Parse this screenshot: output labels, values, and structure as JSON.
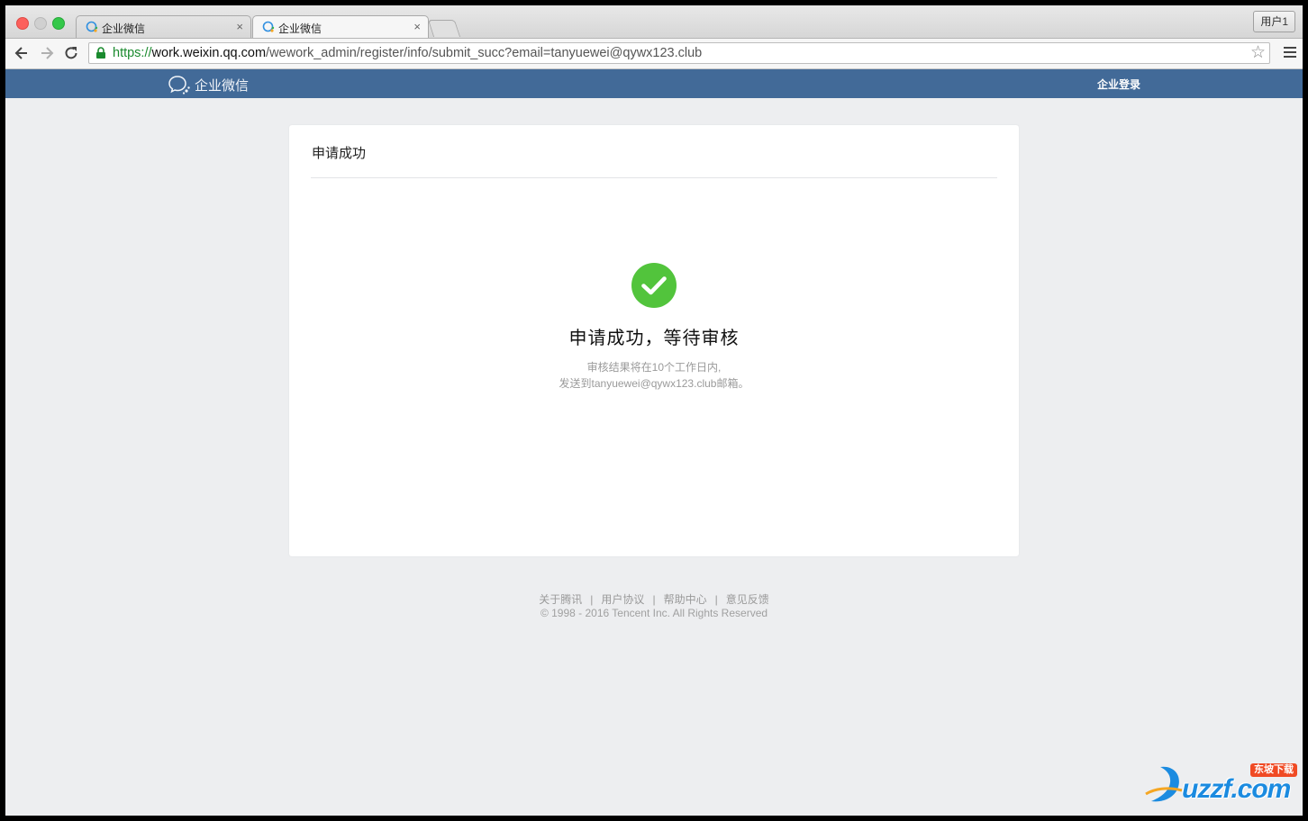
{
  "browser": {
    "tabs": [
      {
        "label": "企业微信",
        "active": false
      },
      {
        "label": "企业微信",
        "active": true
      }
    ],
    "user_button": "用户1",
    "url_scheme": "https://",
    "url_host": "work.weixin.qq.com",
    "url_path": "/wework_admin/register/info/submit_succ?email=tanyuewei@qywx123.club"
  },
  "header": {
    "logo_text": "企业微信",
    "login_label": "企业登录"
  },
  "card": {
    "title": "申请成功",
    "success_title": "申请成功，等待审核",
    "desc_line1": "审核结果将在10个工作日内,",
    "desc_line2": "发送到tanyuewei@qywx123.club邮箱。"
  },
  "footer": {
    "links": [
      "关于腾讯",
      "用户协议",
      "帮助中心",
      "意见反馈"
    ],
    "separator": "|",
    "copyright": "© 1998 - 2016 Tencent Inc. All Rights Reserved"
  },
  "watermark": {
    "badge": "东坡下载",
    "text": "uzzf.com"
  },
  "colors": {
    "header_bg": "#426a98",
    "success_green": "#52c43c",
    "page_bg": "#edeef0"
  }
}
